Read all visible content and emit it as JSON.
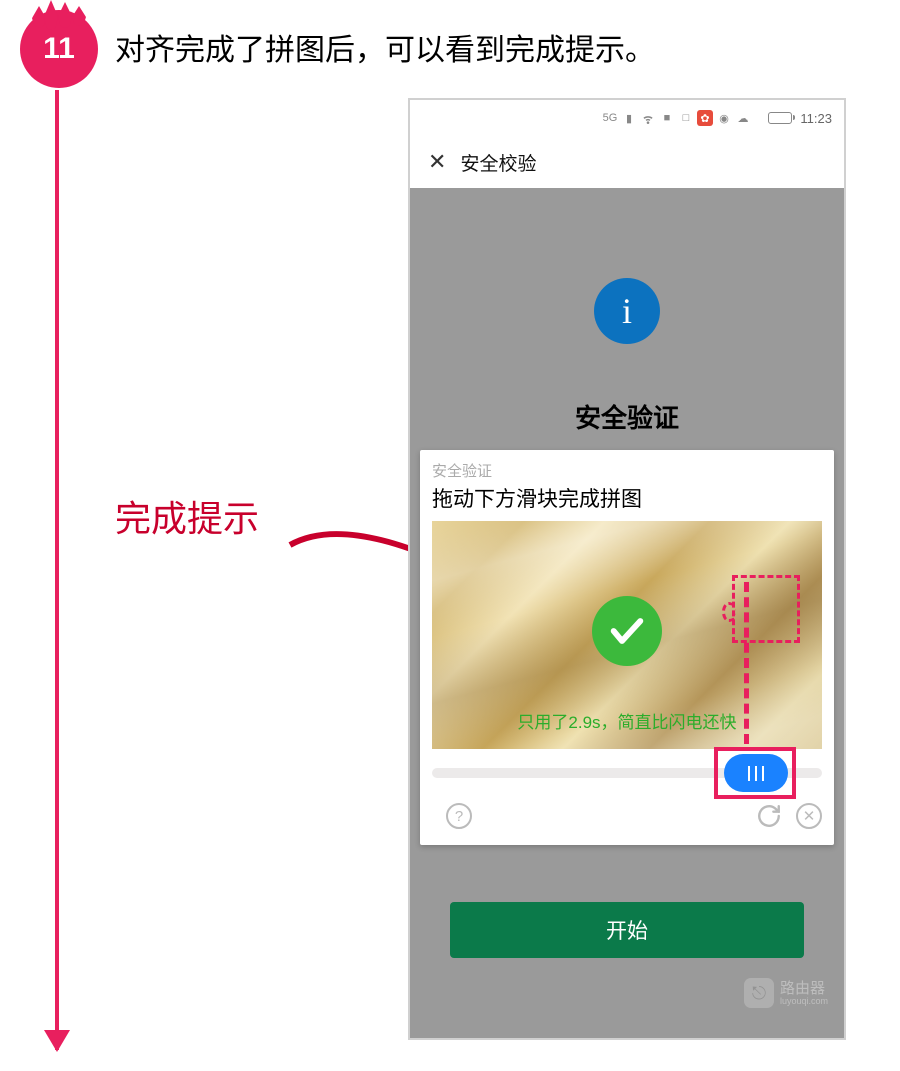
{
  "step": {
    "number": "11",
    "description": "对齐完成了拼图后，可以看到完成提示。"
  },
  "annotation": {
    "label": "完成提示"
  },
  "phone": {
    "statusBar": {
      "networkLabel": "5G",
      "time": "11:23"
    },
    "header": {
      "closeIcon": "✕",
      "title": "安全校验"
    },
    "infoIcon": "i",
    "securityTitle": "安全验证",
    "captcha": {
      "smallLabel": "安全验证",
      "instruction": "拖动下方滑块完成拼图",
      "successText": "只用了2.9s，简直比闪电还快",
      "helpIcon": "?",
      "closeIcon": "✕"
    },
    "startButton": "开始"
  },
  "watermark": {
    "title": "路由器",
    "subtitle": "luyouqi.com"
  }
}
